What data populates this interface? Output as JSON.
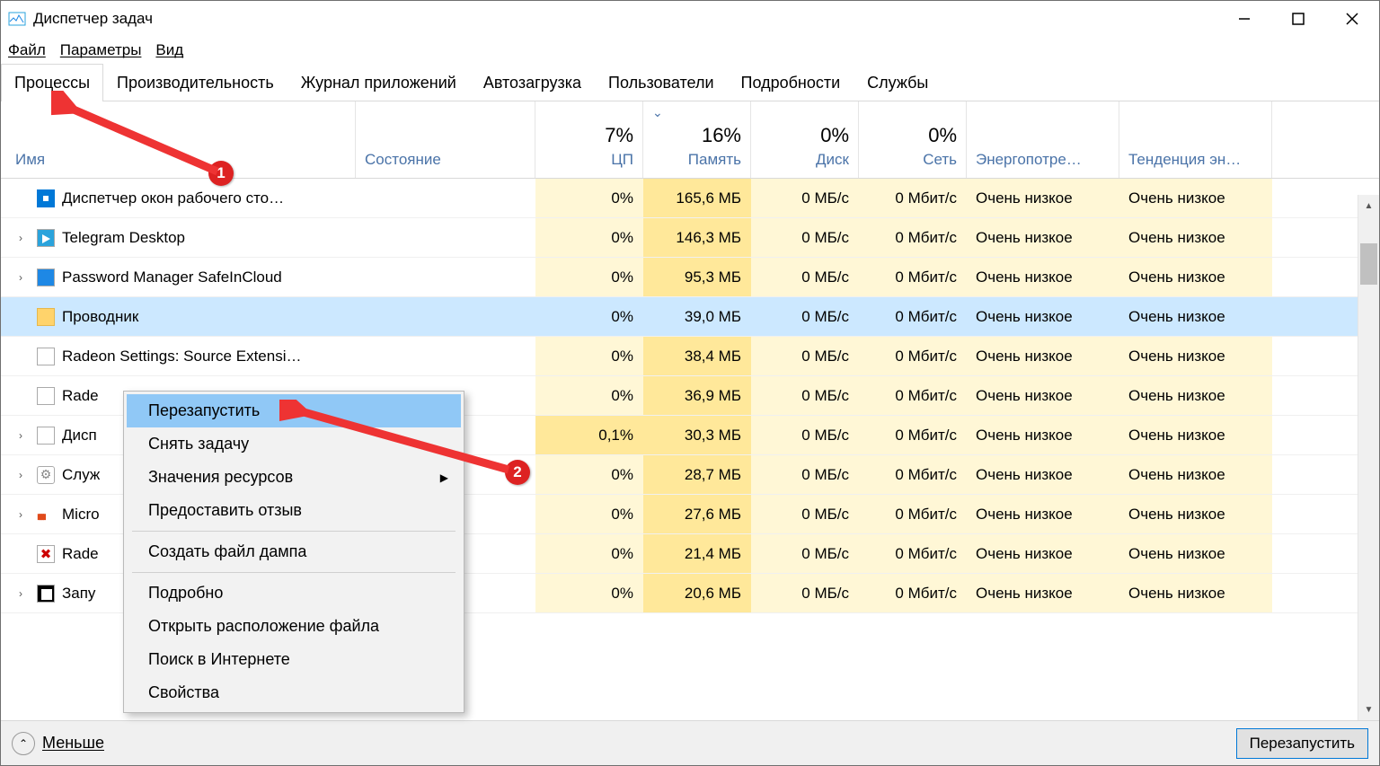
{
  "window": {
    "title": "Диспетчер задач"
  },
  "menu": {
    "file": "Файл",
    "options": "Параметры",
    "view": "Вид"
  },
  "tabs": [
    "Процессы",
    "Производительность",
    "Журнал приложений",
    "Автозагрузка",
    "Пользователи",
    "Подробности",
    "Службы"
  ],
  "columns": {
    "name": "Имя",
    "status": "Состояние",
    "cpu_pct": "7%",
    "cpu_lbl": "ЦП",
    "mem_pct": "16%",
    "mem_lbl": "Память",
    "disk_pct": "0%",
    "disk_lbl": "Диск",
    "net_pct": "0%",
    "net_lbl": "Сеть",
    "power_lbl": "Энергопотре…",
    "trend_lbl": "Тенденция эн…"
  },
  "rows": [
    {
      "expand": false,
      "icon": "blue",
      "name": "Диспетчер окон рабочего сто…",
      "cpu": "0%",
      "mem": "165,6 МБ",
      "disk": "0 МБ/с",
      "net": "0 Мбит/с",
      "power": "Очень низкое",
      "trend": "Очень низкое"
    },
    {
      "expand": true,
      "icon": "tg",
      "name": "Telegram Desktop",
      "cpu": "0%",
      "mem": "146,3 МБ",
      "disk": "0 МБ/с",
      "net": "0 Мбит/с",
      "power": "Очень низкое",
      "trend": "Очень низкое"
    },
    {
      "expand": true,
      "icon": "safe",
      "name": "Password Manager SafeInCloud",
      "cpu": "0%",
      "mem": "95,3 МБ",
      "disk": "0 МБ/с",
      "net": "0 Мбит/с",
      "power": "Очень низкое",
      "trend": "Очень низкое"
    },
    {
      "expand": false,
      "icon": "folder",
      "name": "Проводник",
      "cpu": "0%",
      "mem": "39,0 МБ",
      "disk": "0 МБ/с",
      "net": "0 Мбит/с",
      "power": "Очень низкое",
      "trend": "Очень низкое",
      "selected": true
    },
    {
      "expand": false,
      "icon": "amd",
      "name": "Radeon Settings: Source Extensi…",
      "cpu": "0%",
      "mem": "38,4 МБ",
      "disk": "0 МБ/с",
      "net": "0 Мбит/с",
      "power": "Очень низкое",
      "trend": "Очень низкое"
    },
    {
      "expand": false,
      "icon": "amd",
      "name": "Rade",
      "cpu": "0%",
      "mem": "36,9 МБ",
      "disk": "0 МБ/с",
      "net": "0 Мбит/с",
      "power": "Очень низкое",
      "trend": "Очень низкое"
    },
    {
      "expand": true,
      "icon": "tm",
      "name": "Дисп",
      "cpu": "0,1%",
      "mem": "30,3 МБ",
      "disk": "0 МБ/с",
      "net": "0 Мбит/с",
      "power": "Очень низкое",
      "trend": "Очень низкое",
      "cpu_hl": true
    },
    {
      "expand": true,
      "icon": "gear",
      "name": "Служ",
      "cpu": "0%",
      "mem": "28,7 МБ",
      "disk": "0 МБ/с",
      "net": "0 Мбит/с",
      "power": "Очень низкое",
      "trend": "Очень низкое"
    },
    {
      "expand": true,
      "icon": "office",
      "name": "Micro",
      "cpu": "0%",
      "mem": "27,6 МБ",
      "disk": "0 МБ/с",
      "net": "0 Мбит/с",
      "power": "Очень низкое",
      "trend": "Очень низкое"
    },
    {
      "expand": false,
      "icon": "rade",
      "name": "Rade",
      "cpu": "0%",
      "mem": "21,4 МБ",
      "disk": "0 МБ/с",
      "net": "0 Мбит/с",
      "power": "Очень низкое",
      "trend": "Очень низкое"
    },
    {
      "expand": true,
      "icon": "black",
      "name": "Запу",
      "cpu": "0%",
      "mem": "20,6 МБ",
      "disk": "0 МБ/с",
      "net": "0 Мбит/с",
      "power": "Очень низкое",
      "trend": "Очень низкое"
    }
  ],
  "context": {
    "items": [
      {
        "label": "Перезапустить",
        "hl": true
      },
      {
        "label": "Снять задачу"
      },
      {
        "label": "Значения ресурсов",
        "submenu": true
      },
      {
        "label": "Предоставить отзыв"
      },
      {
        "sep": true
      },
      {
        "label": "Создать файл дампа"
      },
      {
        "sep": true
      },
      {
        "label": "Подробно"
      },
      {
        "label": "Открыть расположение файла"
      },
      {
        "label": "Поиск в Интернете"
      },
      {
        "label": "Свойства"
      }
    ]
  },
  "bottom": {
    "less": "Меньше",
    "restart": "Перезапустить"
  },
  "annot": {
    "b1": "1",
    "b2": "2"
  }
}
